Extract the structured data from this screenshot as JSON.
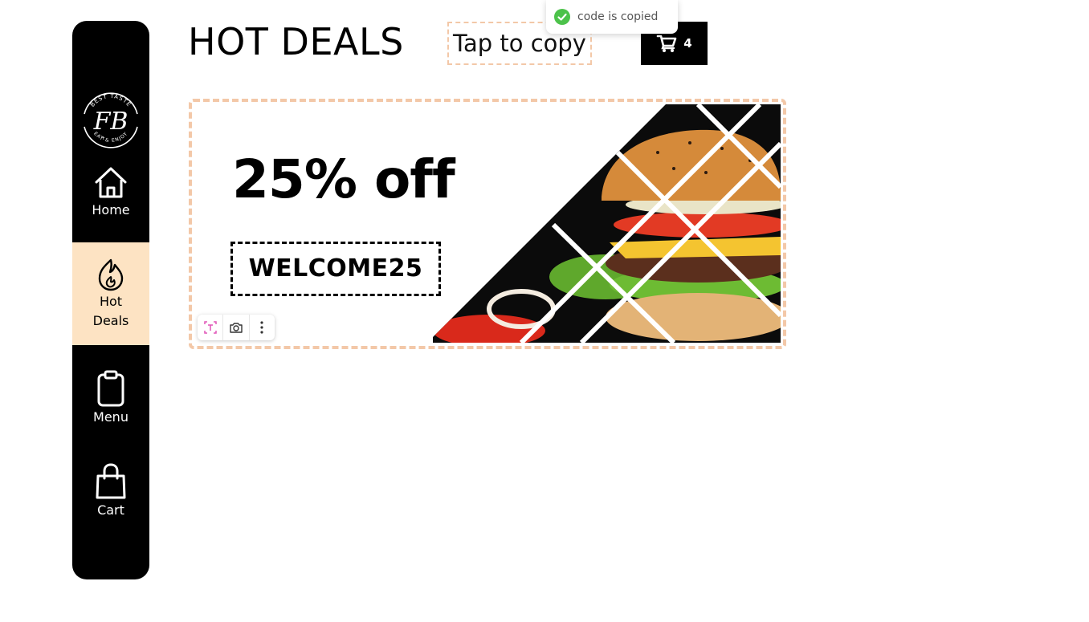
{
  "sidebar": {
    "logo": {
      "icon": "brand-logo",
      "top_text": "BEST TASTE",
      "monogram": "FB",
      "bottom_text": "EAT & ENJOY"
    },
    "items": [
      {
        "label": "Home",
        "icon": "home-icon",
        "active": false
      },
      {
        "label": "Hot Deals",
        "icon": "flame-icon",
        "active": true
      },
      {
        "label": "Menu",
        "icon": "clipboard-icon",
        "active": false
      },
      {
        "label": "Cart",
        "icon": "shopping-bag-icon",
        "active": false
      }
    ],
    "active_color": "#fde3c3"
  },
  "header": {
    "title": "HOT DEALS",
    "tap_to_copy": "Tap to copy",
    "cart_count": "4",
    "cart_icon": "cart-icon"
  },
  "toast": {
    "text": "code is copied",
    "icon": "check-circle-icon",
    "icon_color": "#4cc24a"
  },
  "deal": {
    "title": "25% off",
    "code": "WELCOME25",
    "image": "burger-image",
    "border_color": "#f3c8a8"
  },
  "image_toolbar": {
    "buttons": [
      "text-select-icon",
      "camera-search-icon",
      "more-vertical-icon"
    ]
  }
}
